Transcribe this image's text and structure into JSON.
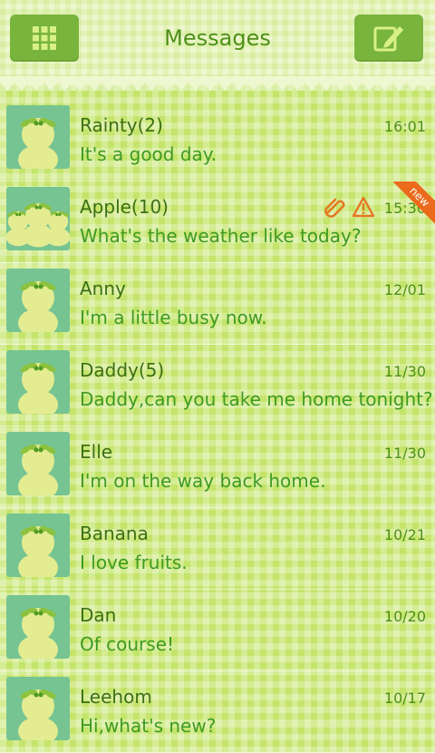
{
  "header": {
    "title": "Messages",
    "menu_icon": "grid-menu-icon",
    "compose_icon": "compose-icon"
  },
  "colors": {
    "accent": "#79b43d",
    "title": "#4f8f1a",
    "new_badge": "#ec6a1c",
    "avatar_bg": "#76c492"
  },
  "conversations": [
    {
      "name": "Rainty(2)",
      "time": "16:01",
      "snippet": "It's a good day."
    },
    {
      "name": "Apple(10)",
      "time": "15:30",
      "snippet": "What's the weather like today?",
      "badge": "new"
    },
    {
      "name": "Anny",
      "time": "12/01",
      "snippet": "I'm a little busy now."
    },
    {
      "name": "Daddy(5)",
      "time": "11/30",
      "snippet": "Daddy,can you take me home tonight?"
    },
    {
      "name": "Elle",
      "time": "11/30",
      "snippet": "I'm on the way back home."
    },
    {
      "name": "Banana",
      "time": "10/21",
      "snippet": "I love fruits."
    },
    {
      "name": "Dan",
      "time": "10/20",
      "snippet": "Of course!"
    },
    {
      "name": "Leehom",
      "time": "10/17",
      "snippet": "Hi,what's new?"
    }
  ]
}
